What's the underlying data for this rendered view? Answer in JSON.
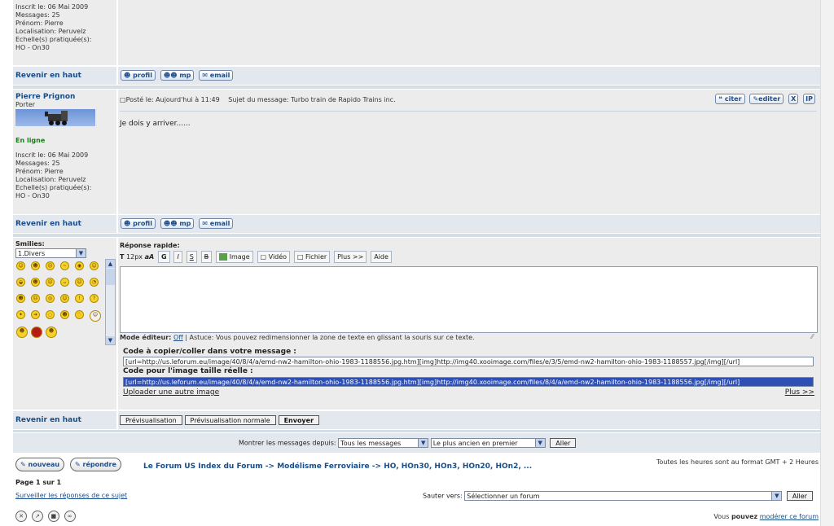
{
  "top_user": {
    "joined": "Inscrit le: 06 Mai 2009",
    "messages": "Messages: 25",
    "firstname": "Prénom: Pierre",
    "location": "Localisation: Peruvelz",
    "scales_label": "Echelle(s) pratiquée(s):",
    "scales": "HO - On30"
  },
  "back_to_top": "Revenir en haut",
  "profile_buttons": {
    "profil": "profil",
    "mp": "mp",
    "email": "email"
  },
  "post": {
    "author": "Pierre Prignon",
    "rank": "Porter",
    "online": "En ligne",
    "joined": "Inscrit le: 06 Mai 2009",
    "messages": "Messages: 25",
    "firstname": "Prénom: Pierre",
    "location": "Localisation: Peruvelz",
    "scales_label": "Echelle(s) pratiquée(s):",
    "scales": "HO - On30",
    "posted": "Posté le: Aujourd'hui à 11:49",
    "subject": "Sujet du message: Turbo train de Rapido Trains inc.",
    "body": "Je dois y arriver......",
    "quote": "citer",
    "edit": "editer",
    "delete": "X",
    "ip": "IP"
  },
  "smilies": {
    "label": "Smilies:",
    "category": "1.Divers",
    "icons": [
      "smile-icon",
      "happy-icon",
      "sad-icon",
      "confused-icon",
      "eyes-icon",
      "grin-icon",
      "cool-icon",
      "laugh-icon",
      "cry-icon",
      "tongue-icon",
      "angry-icon",
      "wink-icon",
      "evil-icon",
      "devil-icon",
      "surprised-icon",
      "blush-icon",
      "exclaim-icon",
      "question-icon",
      "idea-icon",
      "arrow-icon",
      "neutral-icon",
      "teeth-icon",
      "thumbsup-icon",
      "clown-icon",
      "alien-icon",
      "demon-icon",
      "bunny-icon"
    ]
  },
  "quick_reply": {
    "label": "Réponse rapide:",
    "font_size": "12px",
    "bold": "G",
    "italic": "I",
    "underline": "S",
    "strike": "B",
    "image": "Image",
    "video": "Vidéo",
    "file": "Fichier",
    "more": "Plus >>",
    "help": "Aide",
    "mode_label": "Mode éditeur:",
    "mode_value": "Off",
    "tip": "| Astuce: Vous pouvez redimensionner la zone de texte en glissant la souris sur ce texte.",
    "copy_label": "Code à copier/coller dans votre message :",
    "copy_code": "[url=http://us.leforum.eu/image/40/8/4/a/emd-nw2-hamilton-ohio-1983-1188556.jpg.htm][img]http://img40.xooimage.com/files/e/3/5/emd-nw2-hamilton-ohio-1983-1188557.jpg[/img][/url]",
    "fullsize_label": "Code pour l'image taille réelle :",
    "fullsize_code": "[url=http://us.leforum.eu/image/40/8/4/a/emd-nw2-hamilton-ohio-1983-1188556.jpg.htm][img]http://img40.xooimage.com/files/8/4/a/emd-nw2-hamilton-ohio-1983-1188556.jpg[/img][/url]",
    "upload_other": "Uploader une autre image",
    "more_link": "Plus >>"
  },
  "actions": {
    "preview": "Prévisualisation",
    "preview_normal": "Prévisualisation normale",
    "send": "Envoyer"
  },
  "filter": {
    "label": "Montrer les messages depuis:",
    "since": "Tous les messages",
    "order": "Le plus ancien en premier",
    "go": "Aller"
  },
  "footer": {
    "new_topic": "nouveau",
    "reply": "répondre",
    "breadcrumb_site": "Le Forum US Index du Forum",
    "arrow": "->",
    "breadcrumb_cat": "Modélisme Ferroviaire",
    "breadcrumb_forum": "HO, HOn30, HOn3, HOn20, HOn2, ...",
    "timezone": "Toutes les heures sont au format GMT + 2 Heures",
    "page": "Page 1 sur 1",
    "watch": "Surveiller les réponses de ce sujet",
    "jump_label": "Sauter vers:",
    "jump_select": "Sélectionner un forum",
    "jump_go": "Aller",
    "moderate_prefix": "Vous",
    "moderate_bold": "pouvez",
    "moderate_link": "modérer ce forum"
  }
}
